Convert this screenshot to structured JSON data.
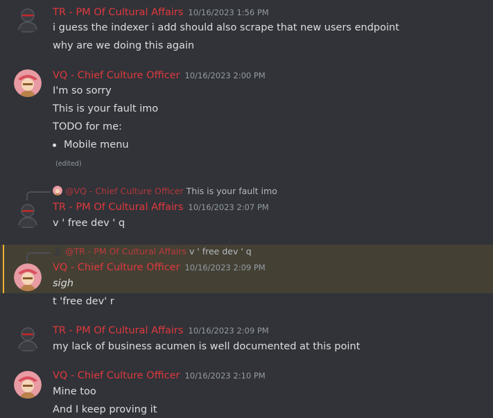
{
  "messages": [
    {
      "author": "TR - PM Of Cultural Affairs",
      "timestamp": "10/16/2023 1:56 PM",
      "lines": [
        "i guess the indexer i add should also scrape that new users endpoint",
        "why are we doing this again"
      ]
    },
    {
      "author": "VQ - Chief Culture Officer",
      "timestamp": "10/16/2023 2:00 PM",
      "lines": [
        "I'm so sorry",
        "This is your fault imo",
        "TODO for me:"
      ],
      "bullets": [
        "Mobile menu"
      ],
      "edited": "(edited)"
    },
    {
      "reply": {
        "author": "@VQ - Chief Culture Officer",
        "text": "This is your fault imo"
      },
      "author": "TR - PM Of Cultural Affairs",
      "timestamp": "10/16/2023 2:07 PM",
      "lines": [
        "v ' free dev ' q"
      ]
    },
    {
      "reply": {
        "author": "@TR - PM Of Cultural Affairs",
        "text": "v ' free dev ' q"
      },
      "author": "VQ - Chief Culture Officer",
      "timestamp": "10/16/2023 2:09 PM",
      "lines": [
        "sigh",
        "t 'free dev' r"
      ]
    },
    {
      "author": "TR - PM Of Cultural Affairs",
      "timestamp": "10/16/2023 2:09 PM",
      "lines": [
        "my lack of business acumen is well documented at this point"
      ]
    },
    {
      "author": "VQ - Chief Culture Officer",
      "timestamp": "10/16/2023 2:10 PM",
      "lines": [
        "Mine too",
        "And I keep proving it"
      ]
    }
  ],
  "colors": {
    "background": "#313338",
    "author_name": "#e0393e",
    "highlight": "#444034",
    "highlight_bar": "#f0b232"
  },
  "icons": {
    "tr_avatar": "default-user-avatar-icon",
    "vq_avatar": "anime-character-avatar-icon"
  }
}
